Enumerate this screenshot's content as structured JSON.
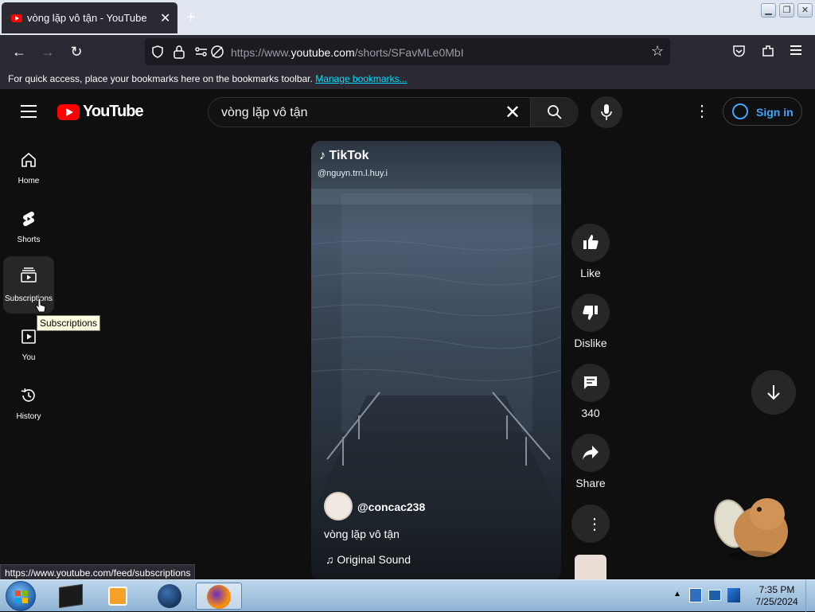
{
  "browser": {
    "tab_title": "vòng lặp vô tận - YouTube",
    "tab_close": "✕",
    "new_tab": "+",
    "url_prefix": "https://www.",
    "url_host": "youtube.com",
    "url_path": "/shorts/SFavMLe0MbI",
    "bookmarks_text": "For quick access, place your bookmarks here on the bookmarks toolbar.",
    "manage_bookmarks": "Manage bookmarks..."
  },
  "youtube": {
    "logo_text": "YouTube",
    "search_value": "vòng lặp vô tận",
    "sign_in": "Sign in"
  },
  "sidebar": {
    "items": [
      {
        "label": "Home",
        "icon": "home-icon"
      },
      {
        "label": "Shorts",
        "icon": "shorts-icon"
      },
      {
        "label": "Subscriptions",
        "icon": "subscriptions-icon"
      },
      {
        "label": "You",
        "icon": "you-icon"
      },
      {
        "label": "History",
        "icon": "history-icon"
      }
    ],
    "tooltip": "Subscriptions"
  },
  "video": {
    "watermark": "TikTok",
    "tiktok_handle": "@nguyn.trn.l.huy.i",
    "channel": "@concac238",
    "title": "vòng lặp vô tận",
    "sound": "Original Sound"
  },
  "actions": {
    "like": "Like",
    "dislike": "Dislike",
    "comments": "340",
    "share": "Share"
  },
  "status_url": "https://www.youtube.com/feed/subscriptions",
  "taskbar": {
    "time": "7:35 PM",
    "date": "7/25/2024"
  },
  "colors": {
    "accent": "#ff0000",
    "link": "#3ea6ff",
    "background": "#0f0f0f"
  }
}
